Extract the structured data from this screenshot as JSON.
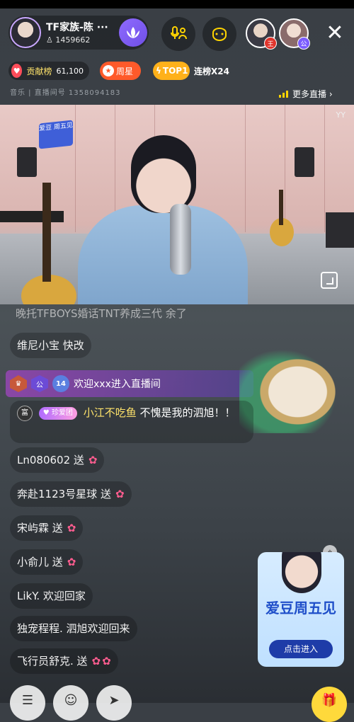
{
  "header": {
    "host_name": "TF家族-陈 ···",
    "fans_count": "1459662",
    "lotus_icon": "lotus-icon",
    "mic_icon": "mic-link-icon",
    "follow_icon": "follow-icon",
    "viewers": [
      {
        "badge": "王",
        "badge_color": "#e0342c"
      },
      {
        "badge": "公",
        "badge_color": "#7b5cff"
      }
    ],
    "close_label": "✕"
  },
  "badges": {
    "contribution": {
      "label": "贡献榜",
      "value": "61,100"
    },
    "weekly_star": {
      "label": "周星"
    },
    "top": {
      "label": "TOP1"
    },
    "streak": {
      "label": "连榜X24"
    }
  },
  "subline": {
    "text": "音乐 | 直播间号 1358094183"
  },
  "more_live": {
    "label": "更多直播 ›"
  },
  "video": {
    "watermark": "YY",
    "sign_text": "爱豆 周五见"
  },
  "chat": {
    "faded_line": "晚托TFBOYS婚话TNT养成三代 余了",
    "items": [
      {
        "text": "维尼小宝 快改",
        "roses": 0
      },
      {
        "text": "Ln080602 送",
        "roses": 1
      },
      {
        "text": "奔赴1123号星球 送",
        "roses": 1
      },
      {
        "text": "宋屿霖 送",
        "roses": 1
      },
      {
        "text": "小俞儿 送",
        "roses": 1
      },
      {
        "text": "LikY. 欢迎回家",
        "roses": 0
      },
      {
        "text": "独宠程程. 泗旭欢迎回来",
        "roses": 0
      },
      {
        "text": "飞行员舒克. 送",
        "roses": 2
      }
    ],
    "welcome": {
      "badge_level": "14",
      "text": "欢迎xxx进入直播间"
    },
    "main_message": {
      "rich_badge": "富",
      "fan_badge": "珍爱团",
      "name": "小江不吃鱼",
      "text": "不愧是我的泗旭！！"
    }
  },
  "promo": {
    "title": "爱豆周五见",
    "button_label": "点击进入"
  },
  "bottom": {
    "gift_icon": "gift-icon"
  }
}
